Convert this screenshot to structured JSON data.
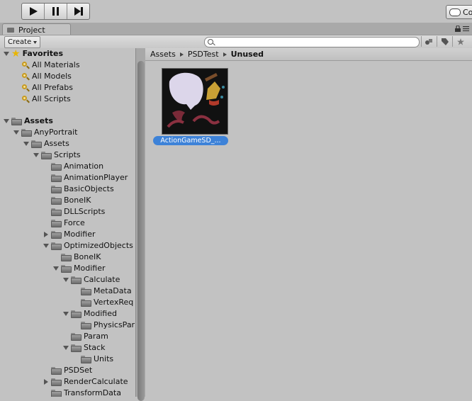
{
  "toolbar": {
    "play_icon": "play-icon",
    "pause_icon": "pause-icon",
    "step_icon": "step-icon",
    "collab_label": "Co"
  },
  "panel": {
    "tab_label": "Project"
  },
  "project_toolbar": {
    "create_label": "Create",
    "search_placeholder": ""
  },
  "tree": {
    "favorites": {
      "label": "Favorites",
      "items": [
        "All Materials",
        "All Models",
        "All Prefabs",
        "All Scripts"
      ]
    },
    "assets_label": "Assets",
    "nodes": [
      {
        "label": "AnyPortrait",
        "depth": 1,
        "expand": "down"
      },
      {
        "label": "Assets",
        "depth": 2,
        "expand": "down"
      },
      {
        "label": "Scripts",
        "depth": 3,
        "expand": "down"
      },
      {
        "label": "Animation",
        "depth": 4,
        "expand": "none"
      },
      {
        "label": "AnimationPlayer",
        "depth": 4,
        "expand": "none"
      },
      {
        "label": "BasicObjects",
        "depth": 4,
        "expand": "none"
      },
      {
        "label": "BoneIK",
        "depth": 4,
        "expand": "none"
      },
      {
        "label": "DLLScripts",
        "depth": 4,
        "expand": "none"
      },
      {
        "label": "Force",
        "depth": 4,
        "expand": "none"
      },
      {
        "label": "Modifier",
        "depth": 4,
        "expand": "right"
      },
      {
        "label": "OptimizedObjects",
        "depth": 4,
        "expand": "down"
      },
      {
        "label": "BoneIK",
        "depth": 5,
        "expand": "none"
      },
      {
        "label": "Modifier",
        "depth": 5,
        "expand": "down"
      },
      {
        "label": "Calculate",
        "depth": 6,
        "expand": "down"
      },
      {
        "label": "MetaData",
        "depth": 7,
        "expand": "none"
      },
      {
        "label": "VertexReq",
        "depth": 7,
        "expand": "none"
      },
      {
        "label": "Modified",
        "depth": 6,
        "expand": "down"
      },
      {
        "label": "PhysicsPar",
        "depth": 7,
        "expand": "none"
      },
      {
        "label": "Param",
        "depth": 6,
        "expand": "none"
      },
      {
        "label": "Stack",
        "depth": 6,
        "expand": "down"
      },
      {
        "label": "Units",
        "depth": 7,
        "expand": "none"
      },
      {
        "label": "PSDSet",
        "depth": 4,
        "expand": "none"
      },
      {
        "label": "RenderCalculate",
        "depth": 4,
        "expand": "right"
      },
      {
        "label": "TransformData",
        "depth": 4,
        "expand": "none"
      }
    ]
  },
  "breadcrumb": [
    "Assets",
    "PSDTest",
    "Unused"
  ],
  "assets": [
    {
      "name": "ActionGameSD_..."
    }
  ]
}
